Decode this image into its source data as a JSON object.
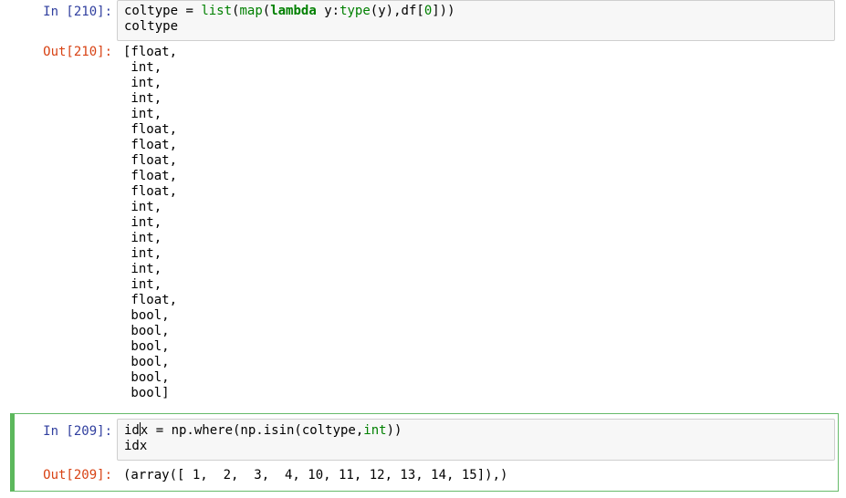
{
  "cells": [
    {
      "in_prompt": "In [210]:",
      "code": {
        "line1": {
          "var": "coltype",
          "eq": " = ",
          "list": "list",
          "p1": "(",
          "map": "map",
          "p2": "(",
          "lambda": "lambda",
          "arg": " y:",
          "type": "type",
          "rest": "(y),df[",
          "zero": "0",
          "end": "]))"
        },
        "line2": "coltype"
      },
      "out_prompt": "Out[210]:",
      "output_lines": [
        "[float,",
        " int,",
        " int,",
        " int,",
        " int,",
        " float,",
        " float,",
        " float,",
        " float,",
        " float,",
        " int,",
        " int,",
        " int,",
        " int,",
        " int,",
        " int,",
        " float,",
        " bool,",
        " bool,",
        " bool,",
        " bool,",
        " bool,",
        " bool]"
      ]
    },
    {
      "in_prompt": "In [209]:",
      "code": {
        "line1": {
          "pre_cursor": "id",
          "post_cursor": "x = np.where(np.isin(coltype,",
          "int": "int",
          "end": "))"
        },
        "line2": "idx"
      },
      "out_prompt": "Out[209]:",
      "output": "(array([ 1,  2,  3,  4, 10, 11, 12, 13, 14, 15]),)"
    }
  ],
  "colors": {
    "in_prompt": "#303f9f",
    "out_prompt": "#d84315",
    "selected_cell_border": "#5cb85c",
    "keyword": "#008000"
  }
}
